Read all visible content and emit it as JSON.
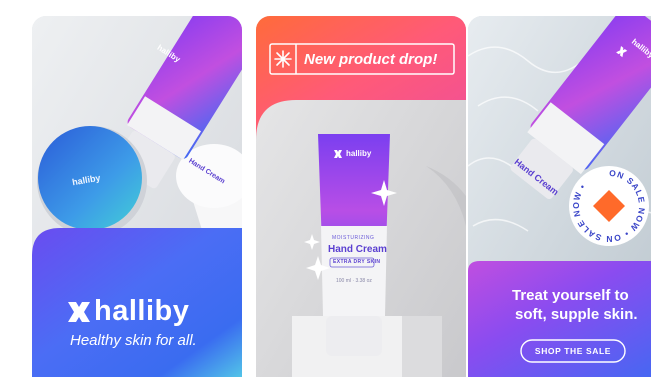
{
  "cards": [
    {
      "brand": "halliby",
      "tagline": "Healthy skin for all.",
      "jar_label": "halliby",
      "tube_brand": "halliby",
      "tube_name": "Hand Cream"
    },
    {
      "banner": "New product drop!",
      "tube_brand": "halliby",
      "tube_small": "MOISTURIZING",
      "tube_name": "Hand Cream",
      "tube_badge": "EXTRA DRY SKIN",
      "tube_volume": "100 ml · 3.38 oz"
    },
    {
      "tube_brand": "halliby",
      "tube_name": "Hand Cream",
      "sticker": "ON SALE NOW • ON SALE NOW •",
      "headline_line1": "Treat yourself to",
      "headline_line2": "soft, supple skin.",
      "cta": "SHOP THE SALE"
    }
  ],
  "colors": {
    "purple": "#8a2be2",
    "blue": "#3a5cf0",
    "pink": "#e0409a",
    "orange": "#ff6a2a",
    "coral": "#ff5a5f"
  },
  "icons": [
    "halliby-logo-icon",
    "sparkle-icon",
    "star-icon"
  ]
}
